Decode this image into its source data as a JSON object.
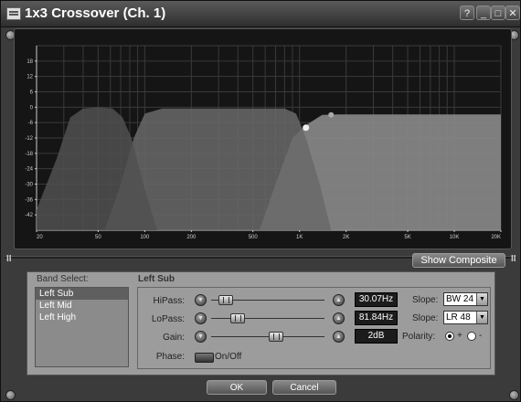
{
  "window": {
    "title": "1x3 Crossover (Ch. 1)"
  },
  "graph": {
    "y_ticks": [
      "18",
      "12",
      "6",
      "0",
      "-6",
      "-12",
      "-18",
      "-24",
      "-30",
      "-36",
      "-42"
    ],
    "x_ticks": [
      "20",
      "50",
      "100",
      "200",
      "500",
      "1K",
      "2K",
      "5K",
      "10K",
      "20K"
    ],
    "band_colors": {
      "left_sub": "#505050",
      "left_mid": "#696969",
      "left_high": "#8a8a8a"
    }
  },
  "composite_button": "Show Composite",
  "band_select": {
    "caption": "Band Select:",
    "items": [
      "Left Sub",
      "Left Mid",
      "Left High"
    ],
    "selected": "Left Sub"
  },
  "band_name": "Left Sub",
  "controls": {
    "hipass": {
      "label": "HiPass:",
      "value": "30.07Hz",
      "slider": 0.07
    },
    "lopass": {
      "label": "LoPass:",
      "value": "81.84Hz",
      "slider": 0.19
    },
    "gain": {
      "label": "Gain:",
      "value": "2dB",
      "slider": 0.58
    },
    "phase": {
      "label": "Phase:",
      "toggle": "On/Off"
    }
  },
  "slopes": [
    {
      "label": "Slope:",
      "value": "BW 24"
    },
    {
      "label": "Slope:",
      "value": "LR 48"
    }
  ],
  "polarity": {
    "label": "Polarity:",
    "plus": "+",
    "minus": "-",
    "selected": "+"
  },
  "buttons": {
    "ok": "OK",
    "cancel": "Cancel"
  }
}
